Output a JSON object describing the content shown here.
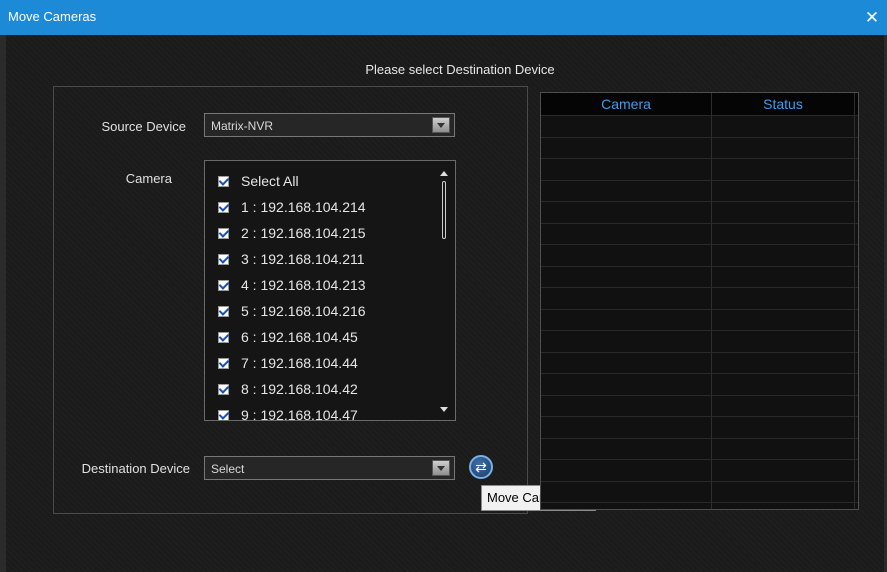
{
  "window": {
    "title": "Move Cameras"
  },
  "heading": "Please select Destination Device",
  "source": {
    "label": "Source Device",
    "value": "Matrix-NVR"
  },
  "camera": {
    "label": "Camera",
    "items": [
      {
        "text": "Select All",
        "checked": true
      },
      {
        "text": "1 : 192.168.104.214",
        "checked": true
      },
      {
        "text": "2 : 192.168.104.215",
        "checked": true
      },
      {
        "text": "3 : 192.168.104.211",
        "checked": true
      },
      {
        "text": "4 : 192.168.104.213",
        "checked": true
      },
      {
        "text": "5 : 192.168.104.216",
        "checked": true
      },
      {
        "text": "6 : 192.168.104.45",
        "checked": true
      },
      {
        "text": "7 : 192.168.104.44",
        "checked": true
      },
      {
        "text": "8 : 192.168.104.42",
        "checked": true
      },
      {
        "text": "9 : 192.168.104.47",
        "checked": true
      }
    ]
  },
  "destination": {
    "label": "Destination Device",
    "value": "Select"
  },
  "move_button": {
    "tooltip": "Move Cameras",
    "icon": "move-arrows-icon"
  },
  "table": {
    "columns": [
      "Camera",
      "Status"
    ],
    "rows": []
  },
  "colors": {
    "titlebar": "#1c8ad6",
    "accent": "#3d9df0"
  }
}
